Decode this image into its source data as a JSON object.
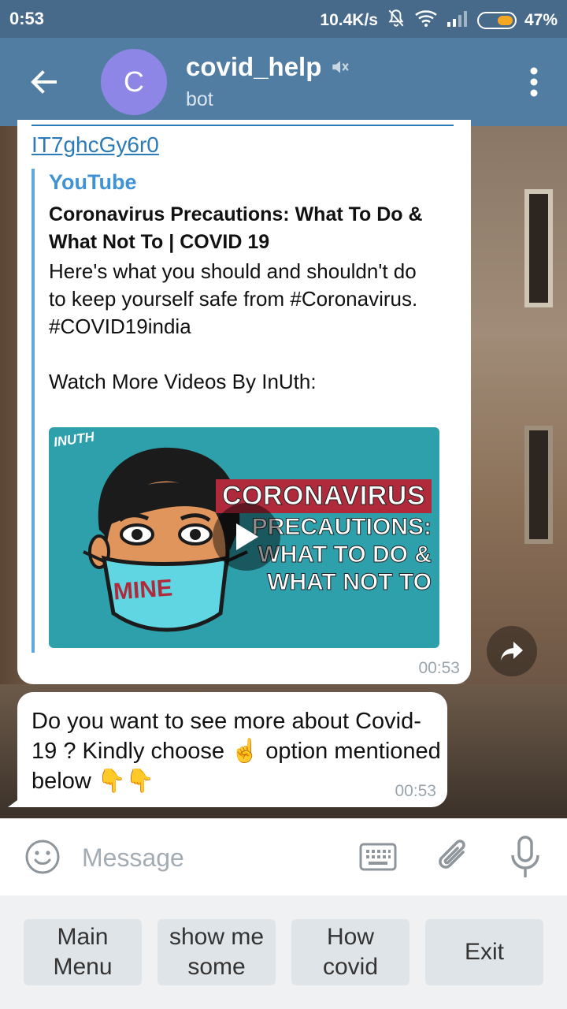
{
  "status_bar": {
    "time": "0:53",
    "net_speed": "10.4K/s",
    "battery": "47%",
    "battery_level": 0.47
  },
  "header": {
    "avatar_letter": "C",
    "title": "covid_help",
    "subtitle": "bot",
    "colors": {
      "header": "#527da3",
      "avatar": "#8e86e6"
    }
  },
  "message_1": {
    "link_tail": "IT7ghcGy6r0",
    "preview": {
      "site": "YouTube",
      "title": "Coronavirus Precautions: What To Do & What Not To | COVID 19",
      "description": "Here's what you should and shouldn't do to keep yourself safe from #Coronavirus.\n#COVID19india\n\nWatch More Videos By InUth:",
      "thumbnail": {
        "brand": "INUTH",
        "mask_text": "MINE",
        "headline_1": "CORONAVIRUS",
        "headline_2": "PRECAUTIONS:",
        "headline_3": "WHAT TO DO &",
        "headline_4": "WHAT NOT TO"
      }
    },
    "time": "00:53"
  },
  "message_2": {
    "text": "Do you want to see more about Covid-19 ? Kindly choose ☝️ option mentioned below 👇👇",
    "time": "00:53"
  },
  "input_bar": {
    "placeholder": "Message"
  },
  "bot_keyboard": {
    "buttons": [
      {
        "label": "Main\nMenu"
      },
      {
        "label": "show me\nsome"
      },
      {
        "label": "How\ncovid"
      },
      {
        "label": "Exit"
      }
    ]
  }
}
